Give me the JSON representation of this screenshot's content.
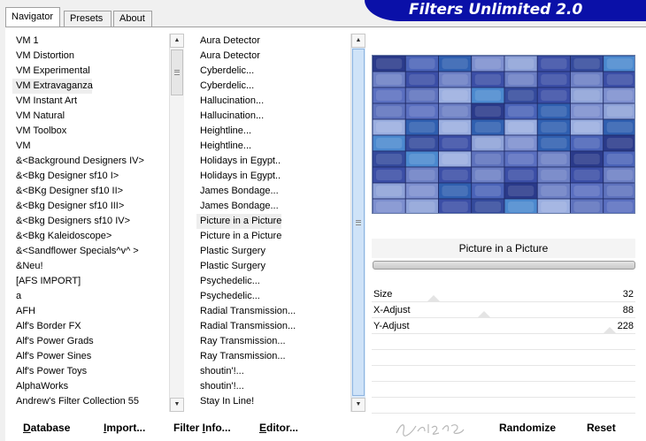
{
  "tabs": [
    {
      "label": "Navigator",
      "active": true
    },
    {
      "label": "Presets",
      "active": false
    },
    {
      "label": "About",
      "active": false
    }
  ],
  "title": "Filters Unlimited 2.0",
  "categories": [
    "VM 1",
    "VM Distortion",
    "VM Experimental",
    "VM Extravaganza",
    "VM Instant Art",
    "VM Natural",
    "VM Toolbox",
    "VM",
    "&<Background Designers IV>",
    "&<Bkg Designer sf10 I>",
    "&<BKg Designer sf10 II>",
    "&<Bkg Designer sf10 III>",
    "&<Bkg Designers sf10 IV>",
    "&<Bkg Kaleidoscope>",
    "&<Sandflower Specials^v^ >",
    "&Neu!",
    "[AFS IMPORT]",
    "a",
    "AFH",
    "Alf's Border FX",
    "Alf's Power Grads",
    "Alf's Power Sines",
    "Alf's Power Toys",
    "AlphaWorks",
    "Andrew's Filter Collection 55"
  ],
  "selected_category": "VM Extravaganza",
  "filters": [
    "Aura Detector",
    "Aura Detector",
    "Cyberdelic...",
    "Cyberdelic...",
    "Hallucination...",
    "Hallucination...",
    "Heightline...",
    "Heightline...",
    "Holidays in Egypt..",
    "Holidays in Egypt..",
    "James Bondage...",
    "James Bondage...",
    "Picture in a Picture",
    "Picture in a Picture",
    "Plastic Surgery",
    "Plastic Surgery",
    "Psychedelic...",
    "Psychedelic...",
    "Radial Transmission...",
    "Radial Transmission...",
    "Ray Transmission...",
    "Ray Transmission...",
    "shoutin'!...",
    "shoutin'!...",
    "Stay In Line!"
  ],
  "selected_filter": "Picture in a Picture",
  "preview": {
    "palette": [
      "#2a3a8a",
      "#3b4ea6",
      "#5a6fc0",
      "#7d8fcf",
      "#9aaee0",
      "#4a63b8",
      "#344a9c",
      "#6c7fc4",
      "#8ea2d8",
      "#5e72bd",
      "#2f5fb0",
      "#4b89cf"
    ]
  },
  "current_filter_name": "Picture in a Picture",
  "params": [
    {
      "label": "Size",
      "value": "32",
      "fraction": 0.125
    },
    {
      "label": "X-Adjust",
      "value": "88",
      "fraction": 0.345
    },
    {
      "label": "Y-Adjust",
      "value": "228",
      "fraction": 0.894
    }
  ],
  "buttons": {
    "database": {
      "first": "D",
      "rest": "atabase"
    },
    "import": {
      "first": "I",
      "rest": "mport..."
    },
    "filter_info": {
      "first": "Filter ",
      "u": "I",
      "rest": "nfo..."
    },
    "editor": {
      "first": "E",
      "rest": "ditor..."
    },
    "randomize": "Randomize",
    "reset": "Reset"
  },
  "colors": {
    "banner": "#0a10a8",
    "selection": "#eeeeee"
  }
}
